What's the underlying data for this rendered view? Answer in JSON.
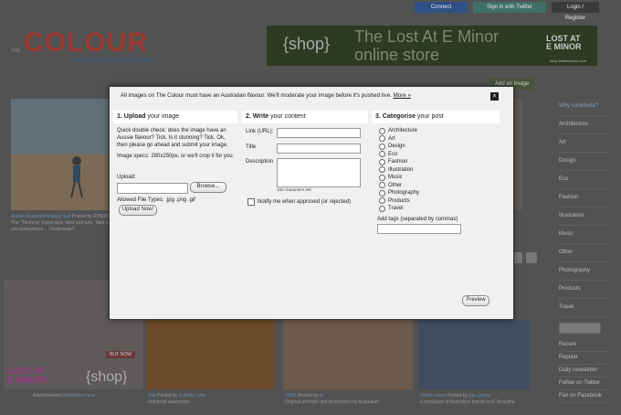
{
  "colors": {
    "accent_red": "#9a3a33",
    "link_blue": "#2f5d8a",
    "modal_bg": "#f0f0f0"
  },
  "topbar": {
    "connect": "Connect",
    "twitter": "Sign in with Twitter",
    "login": "Login / Register"
  },
  "logo": {
    "prefix": "THE",
    "word": "COLOUR",
    "tagline": "AUSSIE CULTURE IN PICTURES"
  },
  "banner": {
    "shop": "{shop}",
    "line1": "The Lost At E Minor",
    "line2": "online store",
    "brand": "LOST AT E MINOR",
    "url": "shop.lostateminor.com"
  },
  "add_button": "Add an Image",
  "sidebar": {
    "categories": [
      "Why contribute?",
      "Architecture",
      "Art",
      "Design",
      "Eco",
      "Fashion",
      "Illustration",
      "Music",
      "Other",
      "Photography",
      "Products",
      "Travel"
    ],
    "links": [
      "Recent",
      "Popular",
      "Daily newsletter",
      "Follow on Twitter",
      "Fan on Facebook"
    ]
  },
  "background_captions": {
    "beach_title": "Aussie Designed Aquatic Suit",
    "beach_by": "Posted by",
    "beach_date": "27/5/2011",
    "beach_text": "The \"Torching\" loved spot, twist and turn. Take your summers with you everywhere... \"Underwater\"",
    "ad_caption": "Advertisement",
    "advertise": "Advertise here",
    "b2_title": "Site",
    "b2_by": "Posted by",
    "b2_author": "Dummit Jubb",
    "b2_text": "Industrial abstraction",
    "b3_title": "XXX1",
    "b3_by": "Posted by",
    "b3_author": "lo",
    "b3_text": "Original portraits and illustrations by Australian",
    "b4_title": "Heron Island",
    "b4_by": "Posted by",
    "b4_author": "Zac Zanno",
    "b4_text": "a small part of Australia's barrier reef. Beautiful",
    "buy_now": "BUY NOW",
    "lost_at": "LOST AT",
    "e_minor": "E MINOR",
    "shop": "{shop}"
  },
  "modal": {
    "notice": "All images on The Colour must have an Australian flavour. We'll moderate your image before it's pushed live.",
    "more": "More »",
    "close": "×",
    "col1": {
      "num": "1.",
      "bold": "Upload",
      "rest": " your image",
      "p1": "Quick double check: does the image have an Aussie flavour? Tick. Is it stunning? Tick. Ok, then please go ahead and submit your image.",
      "p2": "Image specs: 280x250px, or we'll crop it for you.",
      "upload_label": "Upload:",
      "browse": "Browse...",
      "types": "Allowed File Types: .jpg .png .gif",
      "upload_now": "Upload Now!"
    },
    "col2": {
      "num": "2.",
      "bold": "Write",
      "rest": " your content",
      "link_label": "Link (URL):",
      "title_label": "Title",
      "desc_label": "Description",
      "chars_left": "100 characters left",
      "notify": "Notify me when approved (or rejected)"
    },
    "col3": {
      "num": "3.",
      "bold": "Categorise",
      "rest": " your post",
      "categories": [
        "Architecture",
        "Art",
        "Design",
        "Eco",
        "Fashion",
        "Illustration",
        "Music",
        "Other",
        "Photography",
        "Products",
        "Travel"
      ],
      "tags_label": "Add tags (separated by commas)"
    },
    "preview": "Preview"
  }
}
